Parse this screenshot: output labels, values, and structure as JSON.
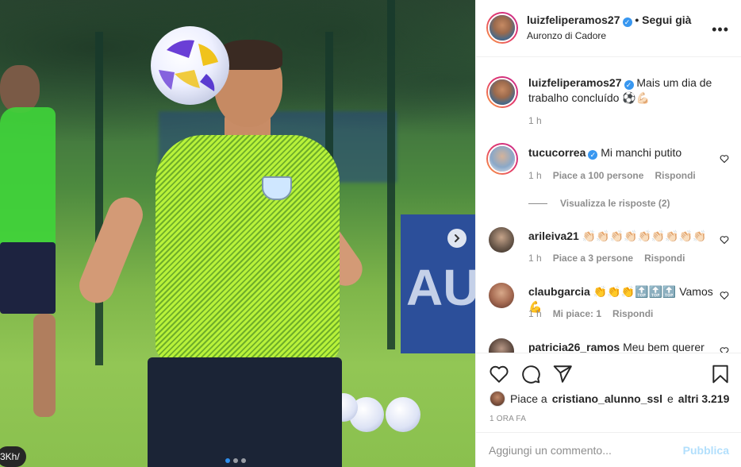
{
  "media": {
    "banner_text": "AU",
    "user_tag": "3Kh/",
    "carousel_dots": 3,
    "active_dot": 1
  },
  "header": {
    "username": "luizfeliperamos27",
    "follow_label": "• Segui già",
    "location": "Auronzo di Cadore",
    "more_icon": "more-horizontal-icon"
  },
  "caption": {
    "username": "luizfeliperamos27",
    "text": "Mais um dia de trabalho concluído ⚽💪🏻",
    "time": "1 h"
  },
  "comments": [
    {
      "username": "tucucorrea",
      "verified": true,
      "text": "Mi manchi putito",
      "time": "1 h",
      "likes": "Piace a 100 persone",
      "reply": "Rispondi"
    },
    {
      "username": "arileiva21",
      "verified": false,
      "text": "👏🏻👏🏻👏🏻👏🏻👏🏻👏🏻👏🏻👏🏻👏🏻",
      "time": "1 h",
      "likes": "Piace a 3 persone",
      "reply": "Rispondi"
    },
    {
      "username": "claubgarcia",
      "verified": false,
      "text": "👏👏👏🔝🔝🔝 Vamos💪",
      "time": "1 h",
      "likes": "Mi piace: 1",
      "reply": "Rispondi"
    },
    {
      "username": "patricia26_ramos",
      "verified": false,
      "text": "Meu bem querer",
      "time": "",
      "likes": "",
      "reply": ""
    }
  ],
  "view_replies": "Visualizza le risposte (2)",
  "actions": {
    "like_icon": "heart-icon",
    "comment_icon": "comment-icon",
    "share_icon": "send-icon",
    "save_icon": "bookmark-icon",
    "likes_prefix": "Piace a",
    "likes_user": "cristiano_alunno_ssl",
    "likes_and": "e",
    "likes_others": "altri 3.219",
    "timestamp": "1 ORA FA"
  },
  "add_comment": {
    "placeholder": "Aggiungi un commento...",
    "post_label": "Pubblica"
  },
  "colors": {
    "accent": "#0095f6",
    "post_disabled": "#b2dffc",
    "verified": "#3897f0",
    "muted": "#8e8e8e"
  }
}
